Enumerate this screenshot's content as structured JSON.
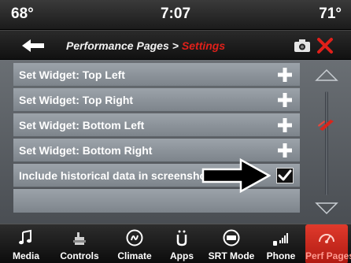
{
  "status": {
    "temp_left": "68°",
    "time": "7:07",
    "temp_right": "71°"
  },
  "header": {
    "breadcrumb_parent": "Performance Pages",
    "breadcrumb_separator": ">",
    "breadcrumb_current": "Settings",
    "icons": [
      "back-arrow-icon",
      "camera-icon",
      "close-icon"
    ],
    "accent_color": "#e0201a"
  },
  "settings": {
    "rows": [
      {
        "label": "Set Widget: Top Left",
        "control": "plus"
      },
      {
        "label": "Set Widget: Top Right",
        "control": "plus"
      },
      {
        "label": "Set Widget: Bottom Left",
        "control": "plus"
      },
      {
        "label": "Set Widget: Bottom Right",
        "control": "plus"
      },
      {
        "label": "Include historical data in screenshot",
        "control": "checkbox",
        "checked": true
      }
    ]
  },
  "nav": {
    "items": [
      {
        "label": "Media",
        "icon": "music-note-icon"
      },
      {
        "label": "Controls",
        "icon": "controls-hand-icon"
      },
      {
        "label": "Climate",
        "icon": "climate-icon"
      },
      {
        "label": "Apps",
        "icon": "apps-icon"
      },
      {
        "label": "SRT Mode",
        "icon": "srt-mode-icon"
      },
      {
        "label": "Phone",
        "icon": "phone-icon"
      },
      {
        "label": "Perf Pages",
        "icon": "perf-pages-icon",
        "active": true
      }
    ]
  }
}
